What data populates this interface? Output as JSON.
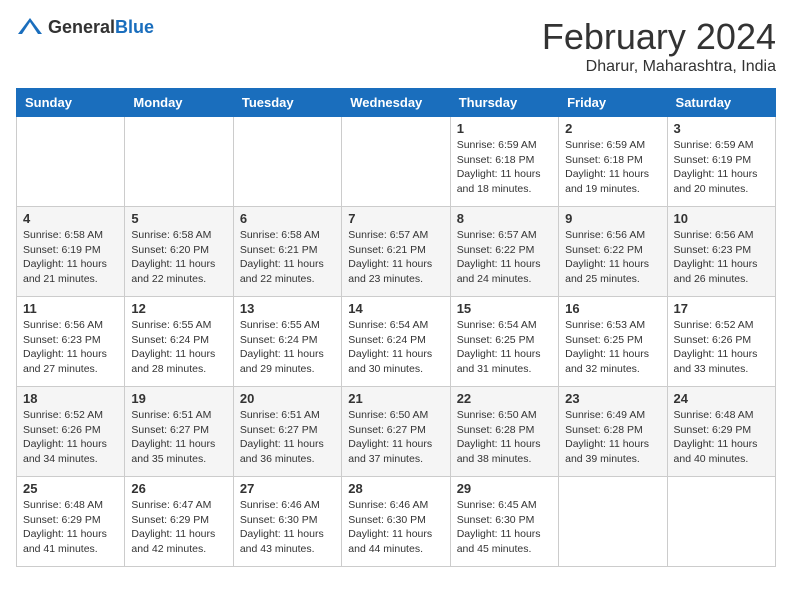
{
  "logo": {
    "text_general": "General",
    "text_blue": "Blue"
  },
  "title": {
    "month_year": "February 2024",
    "location": "Dharur, Maharashtra, India"
  },
  "days_of_week": [
    "Sunday",
    "Monday",
    "Tuesday",
    "Wednesday",
    "Thursday",
    "Friday",
    "Saturday"
  ],
  "weeks": [
    [
      {
        "day": "",
        "info": ""
      },
      {
        "day": "",
        "info": ""
      },
      {
        "day": "",
        "info": ""
      },
      {
        "day": "",
        "info": ""
      },
      {
        "day": "1",
        "info": "Sunrise: 6:59 AM\nSunset: 6:18 PM\nDaylight: 11 hours\nand 18 minutes."
      },
      {
        "day": "2",
        "info": "Sunrise: 6:59 AM\nSunset: 6:18 PM\nDaylight: 11 hours\nand 19 minutes."
      },
      {
        "day": "3",
        "info": "Sunrise: 6:59 AM\nSunset: 6:19 PM\nDaylight: 11 hours\nand 20 minutes."
      }
    ],
    [
      {
        "day": "4",
        "info": "Sunrise: 6:58 AM\nSunset: 6:19 PM\nDaylight: 11 hours\nand 21 minutes."
      },
      {
        "day": "5",
        "info": "Sunrise: 6:58 AM\nSunset: 6:20 PM\nDaylight: 11 hours\nand 22 minutes."
      },
      {
        "day": "6",
        "info": "Sunrise: 6:58 AM\nSunset: 6:21 PM\nDaylight: 11 hours\nand 22 minutes."
      },
      {
        "day": "7",
        "info": "Sunrise: 6:57 AM\nSunset: 6:21 PM\nDaylight: 11 hours\nand 23 minutes."
      },
      {
        "day": "8",
        "info": "Sunrise: 6:57 AM\nSunset: 6:22 PM\nDaylight: 11 hours\nand 24 minutes."
      },
      {
        "day": "9",
        "info": "Sunrise: 6:56 AM\nSunset: 6:22 PM\nDaylight: 11 hours\nand 25 minutes."
      },
      {
        "day": "10",
        "info": "Sunrise: 6:56 AM\nSunset: 6:23 PM\nDaylight: 11 hours\nand 26 minutes."
      }
    ],
    [
      {
        "day": "11",
        "info": "Sunrise: 6:56 AM\nSunset: 6:23 PM\nDaylight: 11 hours\nand 27 minutes."
      },
      {
        "day": "12",
        "info": "Sunrise: 6:55 AM\nSunset: 6:24 PM\nDaylight: 11 hours\nand 28 minutes."
      },
      {
        "day": "13",
        "info": "Sunrise: 6:55 AM\nSunset: 6:24 PM\nDaylight: 11 hours\nand 29 minutes."
      },
      {
        "day": "14",
        "info": "Sunrise: 6:54 AM\nSunset: 6:24 PM\nDaylight: 11 hours\nand 30 minutes."
      },
      {
        "day": "15",
        "info": "Sunrise: 6:54 AM\nSunset: 6:25 PM\nDaylight: 11 hours\nand 31 minutes."
      },
      {
        "day": "16",
        "info": "Sunrise: 6:53 AM\nSunset: 6:25 PM\nDaylight: 11 hours\nand 32 minutes."
      },
      {
        "day": "17",
        "info": "Sunrise: 6:52 AM\nSunset: 6:26 PM\nDaylight: 11 hours\nand 33 minutes."
      }
    ],
    [
      {
        "day": "18",
        "info": "Sunrise: 6:52 AM\nSunset: 6:26 PM\nDaylight: 11 hours\nand 34 minutes."
      },
      {
        "day": "19",
        "info": "Sunrise: 6:51 AM\nSunset: 6:27 PM\nDaylight: 11 hours\nand 35 minutes."
      },
      {
        "day": "20",
        "info": "Sunrise: 6:51 AM\nSunset: 6:27 PM\nDaylight: 11 hours\nand 36 minutes."
      },
      {
        "day": "21",
        "info": "Sunrise: 6:50 AM\nSunset: 6:27 PM\nDaylight: 11 hours\nand 37 minutes."
      },
      {
        "day": "22",
        "info": "Sunrise: 6:50 AM\nSunset: 6:28 PM\nDaylight: 11 hours\nand 38 minutes."
      },
      {
        "day": "23",
        "info": "Sunrise: 6:49 AM\nSunset: 6:28 PM\nDaylight: 11 hours\nand 39 minutes."
      },
      {
        "day": "24",
        "info": "Sunrise: 6:48 AM\nSunset: 6:29 PM\nDaylight: 11 hours\nand 40 minutes."
      }
    ],
    [
      {
        "day": "25",
        "info": "Sunrise: 6:48 AM\nSunset: 6:29 PM\nDaylight: 11 hours\nand 41 minutes."
      },
      {
        "day": "26",
        "info": "Sunrise: 6:47 AM\nSunset: 6:29 PM\nDaylight: 11 hours\nand 42 minutes."
      },
      {
        "day": "27",
        "info": "Sunrise: 6:46 AM\nSunset: 6:30 PM\nDaylight: 11 hours\nand 43 minutes."
      },
      {
        "day": "28",
        "info": "Sunrise: 6:46 AM\nSunset: 6:30 PM\nDaylight: 11 hours\nand 44 minutes."
      },
      {
        "day": "29",
        "info": "Sunrise: 6:45 AM\nSunset: 6:30 PM\nDaylight: 11 hours\nand 45 minutes."
      },
      {
        "day": "",
        "info": ""
      },
      {
        "day": "",
        "info": ""
      }
    ]
  ]
}
